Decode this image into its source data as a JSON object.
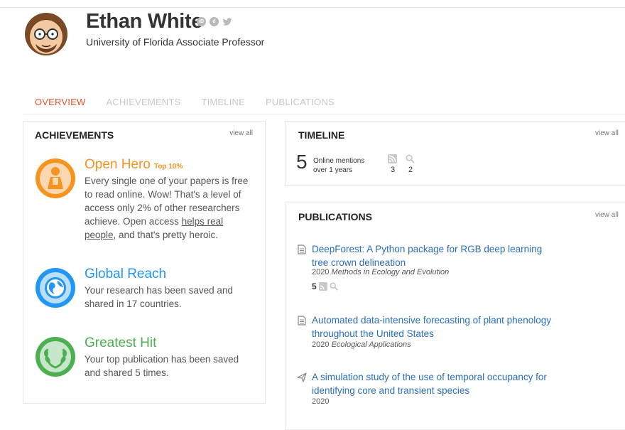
{
  "profile": {
    "name": "Ethan White",
    "subtitle": "University of Florida Associate Professor",
    "icons": [
      "orcid-icon",
      "depsy-icon",
      "twitter-icon"
    ]
  },
  "tabs": [
    {
      "label": "OVERVIEW",
      "active": true
    },
    {
      "label": "ACHIEVEMENTS",
      "active": false
    },
    {
      "label": "TIMELINE",
      "active": false
    },
    {
      "label": "PUBLICATIONS",
      "active": false
    }
  ],
  "achievements": {
    "title": "ACHIEVEMENTS",
    "view_all": "view all",
    "items": [
      {
        "title": "Open Hero",
        "badge": "Top 10%",
        "color": "#f7931e",
        "desc_parts": [
          "Every single one of your papers is free to read online. Wow! That's a level of access only 2% of other researchers achieve. Open access ",
          "helps real people",
          ", and that's pretty heroic."
        ]
      },
      {
        "title": "Global Reach",
        "color": "#2196f3",
        "desc": "Your research has been saved and shared in 17 countries."
      },
      {
        "title": "Greatest Hit",
        "color": "#4caf50",
        "desc": "Your top publication has been saved and shared 5 times."
      }
    ]
  },
  "timeline": {
    "title": "TIMELINE",
    "view_all": "view all",
    "count": "5",
    "label1": "Online mentions",
    "label2": "over 1 years",
    "rss_count": "3",
    "search_count": "2"
  },
  "publications": {
    "title": "PUBLICATIONS",
    "view_all": "view all",
    "items": [
      {
        "title": "DeepForest: A Python package for RGB deep learning tree crown delineation",
        "year": "2020",
        "journal": "Methods in Ecology and Evolution",
        "count": "5",
        "icon": "document-icon"
      },
      {
        "title": "Automated data-intensive forecasting of plant phenology throughout the United States",
        "year": "2020",
        "journal": "Ecological Applications",
        "icon": "document-icon"
      },
      {
        "title": "A simulation study of the use of temporal occupancy for identifying core and transient species",
        "year": "2020",
        "journal": "",
        "icon": "paper-plane-icon"
      }
    ]
  },
  "colors": {
    "accent": "#e5532d",
    "link": "#2a6ebb",
    "open_hero": "#f7931e",
    "global_reach": "#2196f3",
    "greatest_hit": "#4caf50"
  }
}
